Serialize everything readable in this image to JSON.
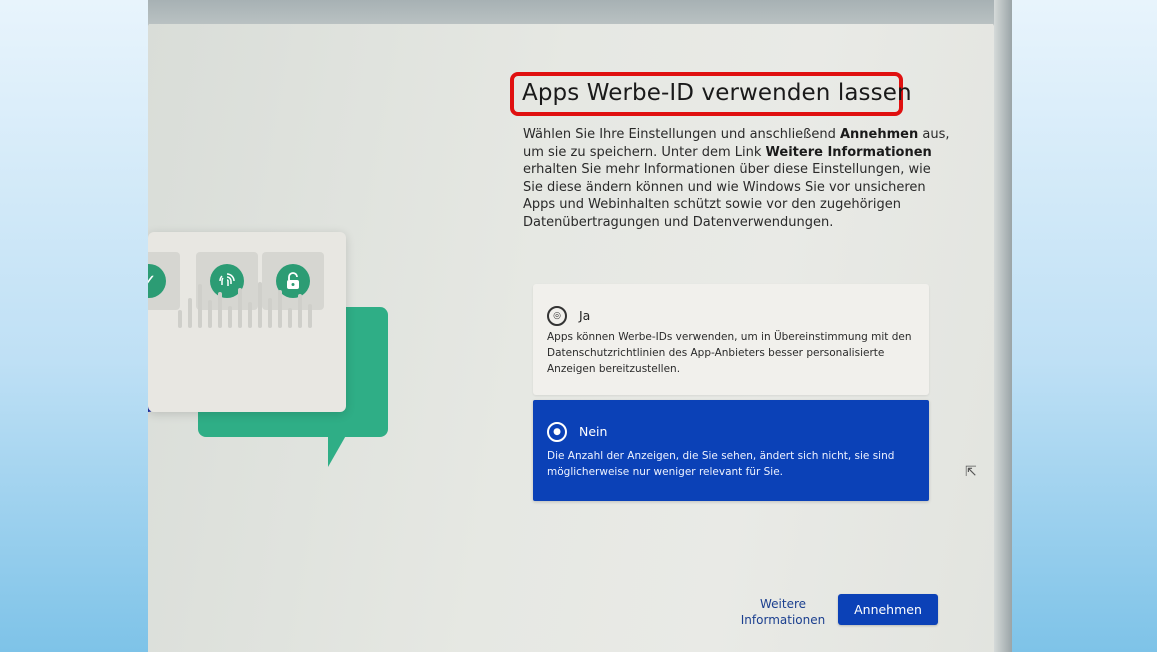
{
  "dialog": {
    "title": "Apps Werbe-ID verwenden lassen",
    "intro": {
      "p1": "Wählen Sie Ihre Einstellungen und anschließend ",
      "b1": "Annehmen",
      "p2": " aus, um sie zu speichern. Unter dem Link ",
      "b2": "Weitere Informationen",
      "p3": " erhalten Sie mehr Informationen über diese Einstellungen, wie Sie diese ändern können und wie Windows Sie vor unsicheren Apps und Webinhalten schützt sowie vor den zugehörigen Datenübertragungen und Datenverwendungen."
    },
    "options": [
      {
        "label": "Ja",
        "description": "Apps können Werbe-IDs verwenden, um in Übereinstimmung mit den Datenschutzrichtlinien des App-Anbieters besser personalisierte Anzeigen bereitzustellen.",
        "icon": "target-icon",
        "selected": false
      },
      {
        "label": "Nein",
        "description": "Die Anzahl der Anzeigen, die Sie sehen, ändert sich nicht, sie sind möglicherweise nur weniger relevant für Sie.",
        "icon": "radio-target-icon",
        "selected": true
      }
    ],
    "more_info_line1": "Weitere",
    "more_info_line2": "Informationen",
    "accept_label": "Annehmen"
  },
  "illustration": {
    "tile_icons": [
      "check-icon",
      "fingerprint-icon",
      "lock-open-icon"
    ]
  },
  "colors": {
    "accent": "#0b41b7",
    "highlight_border": "#e01010",
    "illustration_green": "#2fae86"
  }
}
